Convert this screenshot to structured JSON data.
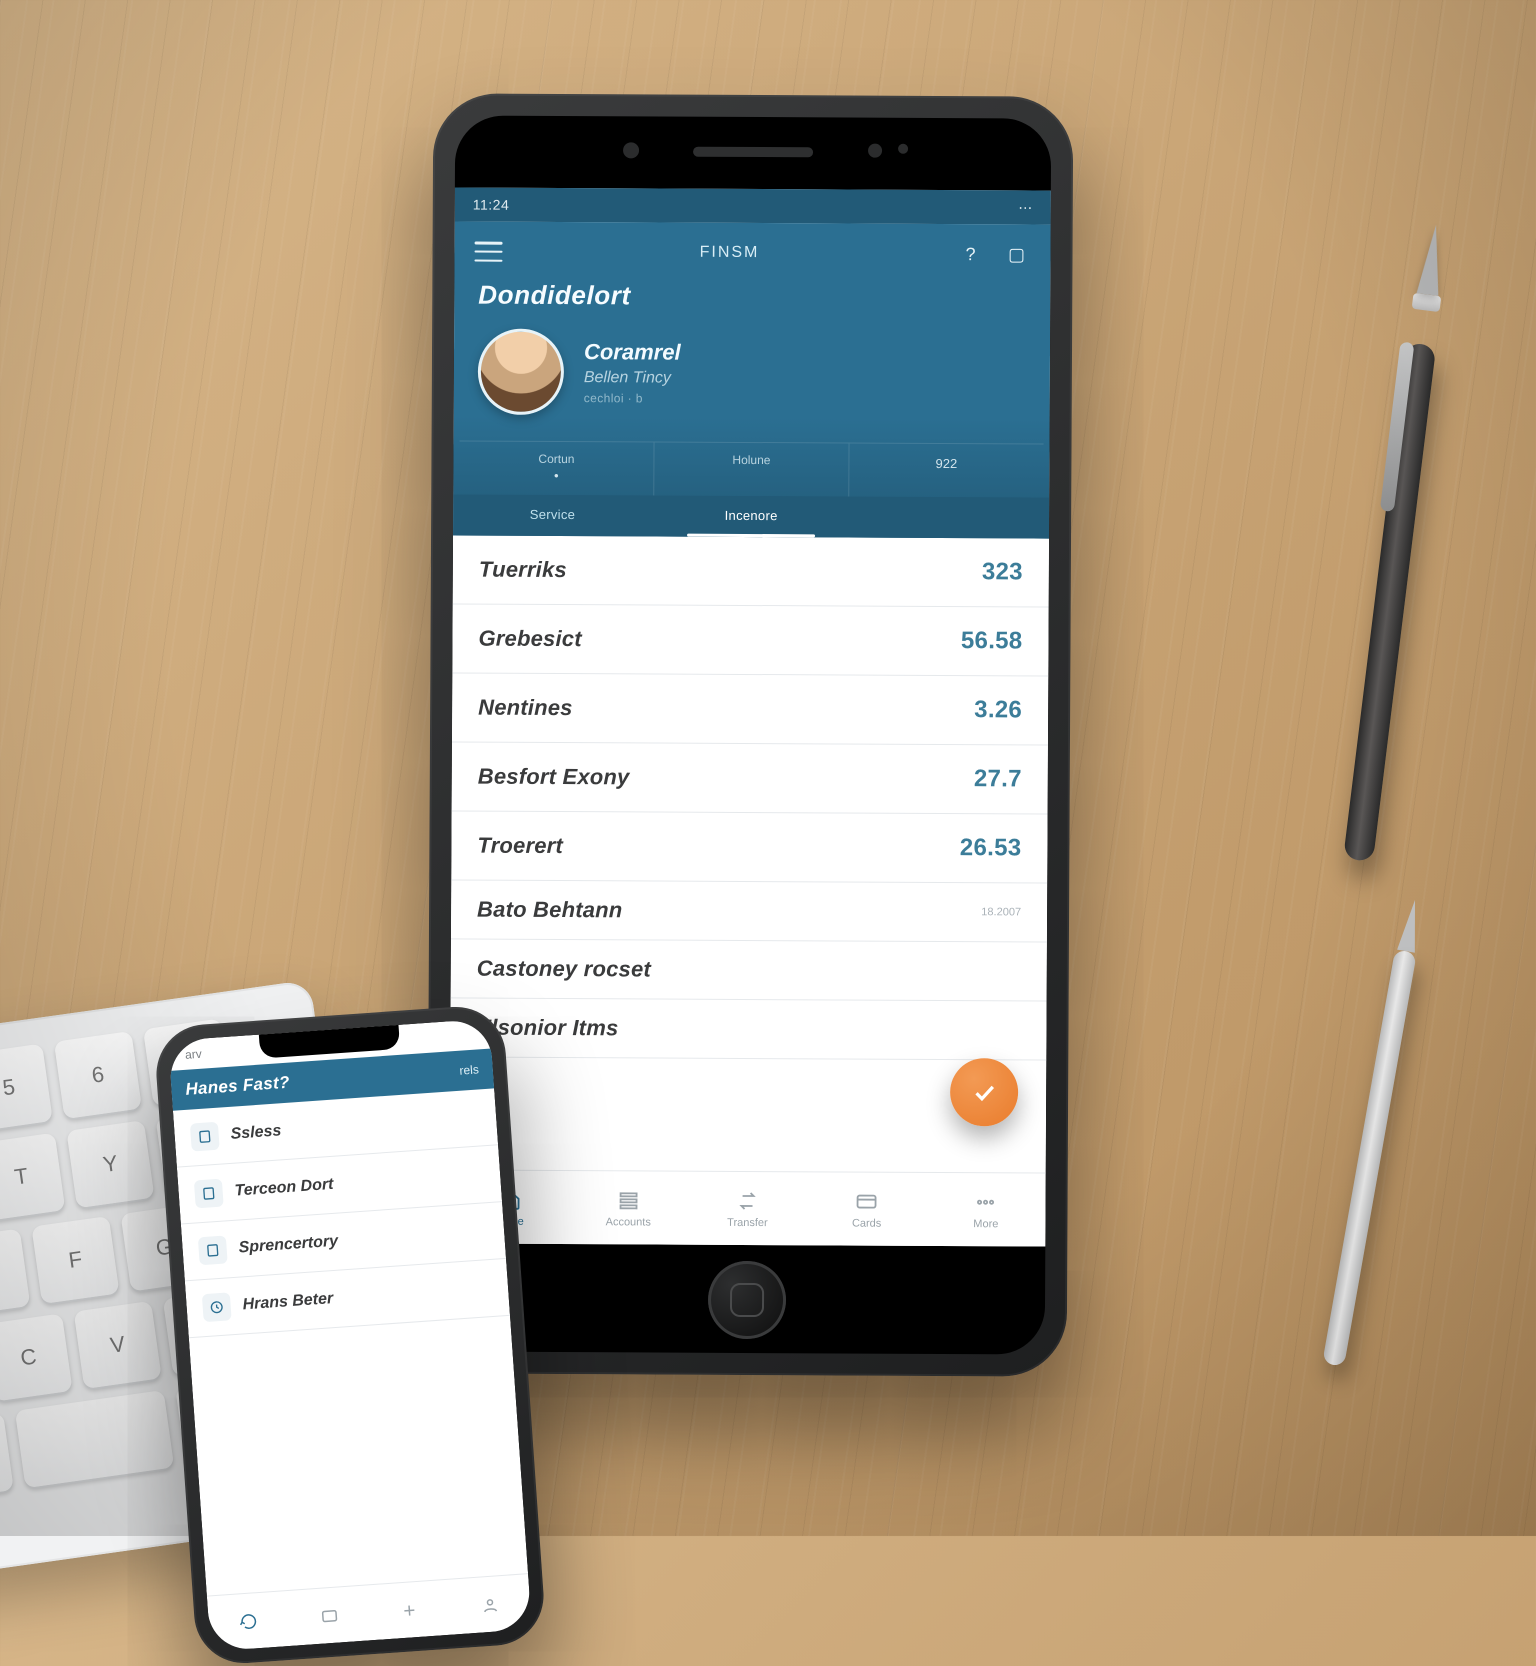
{
  "primary": {
    "status": {
      "time": "11:24",
      "right": "⋯"
    },
    "topbar": {
      "brand": "FINSM",
      "help": "?",
      "card": "▢"
    },
    "title": "Dondidelort",
    "profile": {
      "name": "Coramrel",
      "subtitle": "Bellen Tincy",
      "meta": "cechloi · b"
    },
    "summary": [
      {
        "label": "Cortun",
        "value": "•"
      },
      {
        "label": "Holune",
        "value": ""
      },
      {
        "label": "",
        "value": "922"
      }
    ],
    "tabs": [
      {
        "label": "Service",
        "active": false
      },
      {
        "label": "Incenore",
        "active": true
      },
      {
        "label": "",
        "active": false
      }
    ],
    "rows": [
      {
        "label": "Tuerriks",
        "sub": "",
        "value": "323",
        "note": ""
      },
      {
        "label": "Grebesict",
        "sub": "",
        "value": "56.58",
        "note": ""
      },
      {
        "label": "Nentines",
        "sub": "",
        "value": "3.26",
        "note": ""
      },
      {
        "label": "Besfort Exony",
        "sub": "",
        "value": "27.7",
        "note": ""
      },
      {
        "label": "Troerert",
        "sub": "",
        "value": "26.53",
        "note": ""
      },
      {
        "label": "Bato Behtann",
        "sub": "",
        "value": "",
        "note": "18.2007"
      },
      {
        "label": "Castoney rocset",
        "sub": "",
        "value": "",
        "note": ""
      },
      {
        "label": "Elsonior Itms",
        "sub": "",
        "value": "",
        "note": ""
      }
    ],
    "bottom_nav": [
      {
        "label": "Home"
      },
      {
        "label": "Accounts"
      },
      {
        "label": "Transfer"
      },
      {
        "label": "Cards"
      },
      {
        "label": "More"
      }
    ]
  },
  "secondary": {
    "status": {
      "left": "arv",
      "right": ""
    },
    "title": "Hanes Fast?",
    "action": "rels",
    "rows": [
      {
        "label": "Ssless"
      },
      {
        "label": "Terceon Dort"
      },
      {
        "label": "Sprencertory"
      },
      {
        "label": "Hrans Beter"
      }
    ]
  }
}
